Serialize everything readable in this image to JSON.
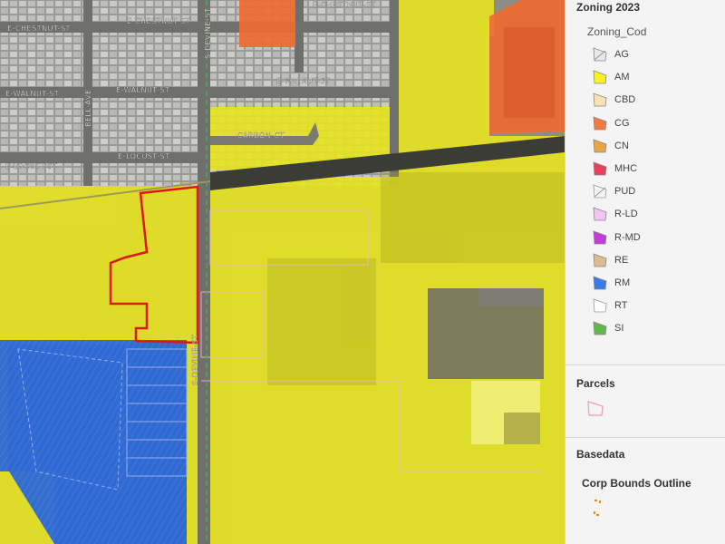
{
  "map": {
    "roads": {
      "chestnut_w": "E-CHESTNUT-ST",
      "chestnut_e": "E-CHESTNUT-ST",
      "chestnut_far": "E-CHESTNUT-ST",
      "walnut_w": "E-WALNUT-ST",
      "walnut_c": "E-WALNUT-ST",
      "walnut_e": "E-WALNUT-ST",
      "locust_w": "E-LOCUST-ST",
      "locust_c": "E-LOCUST-ST",
      "carbon": "CARBON-CT",
      "bell": "BELL-AVE",
      "s_oak": "S-DEVINE-ST",
      "s_main": "S-DEVINE-ST"
    }
  },
  "legend": {
    "zoning": {
      "title": "Zoning 2023",
      "subtitle": "Zoning_Cod",
      "items": [
        {
          "label": "AG",
          "color": "#e8e8e8",
          "hatch": true
        },
        {
          "label": "AM",
          "color": "#f5f227"
        },
        {
          "label": "CBD",
          "color": "#f8e3b6"
        },
        {
          "label": "CG",
          "color": "#ef7a42"
        },
        {
          "label": "CN",
          "color": "#e6a648"
        },
        {
          "label": "MHC",
          "color": "#e6405a"
        },
        {
          "label": "PUD",
          "color": "#f4f4f4",
          "hatch": true
        },
        {
          "label": "R-LD",
          "color": "#f1c7f2"
        },
        {
          "label": "R-MD",
          "color": "#c33bd8"
        },
        {
          "label": "RE",
          "color": "#d9bc8f"
        },
        {
          "label": "RM",
          "color": "#3a7be5"
        },
        {
          "label": "RT",
          "color": "#ffffff"
        },
        {
          "label": "SI",
          "color": "#61b74d"
        }
      ]
    },
    "parcels": {
      "title": "Parcels",
      "color": "#f29ab7"
    },
    "basedata": {
      "title": "Basedata",
      "item_label": "Corp Bounds Outline",
      "color": "#e38a12"
    }
  }
}
